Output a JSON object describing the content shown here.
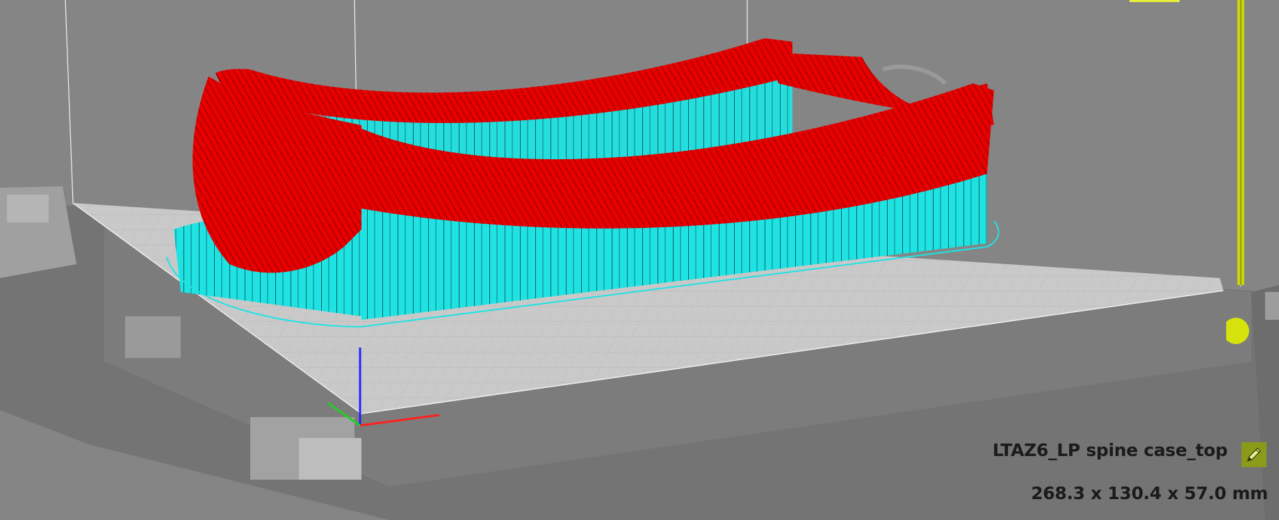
{
  "object": {
    "name": "LTAZ6_LP spine case_top",
    "dimensions": "268.3 x 130.4 x 57.0 mm"
  },
  "icons": {
    "edit": "pencil-icon"
  },
  "colors": {
    "background": "#858585",
    "bed": "#c9c9c9",
    "shell": "#e80000",
    "support": "#1fe3e3",
    "slider": "#c9d60f",
    "edit_button": "#8a9a1a",
    "axis_x": "#ff2020",
    "axis_y": "#20d020",
    "axis_z": "#2020ff"
  }
}
